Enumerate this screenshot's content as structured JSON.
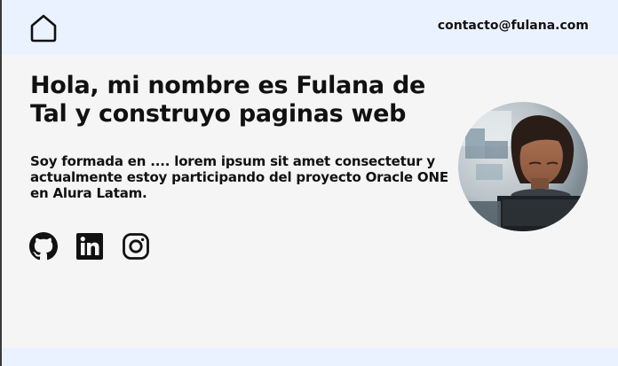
{
  "header": {
    "home_icon": "home-icon",
    "email": "contacto@fulana.com"
  },
  "hero": {
    "title": "Hola, mi nombre es Fulana de Tal y construyo paginas web",
    "description": "Soy formada en .... lorem ipsum sit amet consectetur y actualmente estoy participando del proyecto Oracle ONE en Alura Latam."
  },
  "socials": [
    {
      "icon": "github-icon"
    },
    {
      "icon": "linkedin-icon"
    },
    {
      "icon": "instagram-icon"
    }
  ],
  "colors": {
    "header_bg": "#ebf2ff",
    "page_bg": "#f5f5f5",
    "text": "#111111"
  }
}
